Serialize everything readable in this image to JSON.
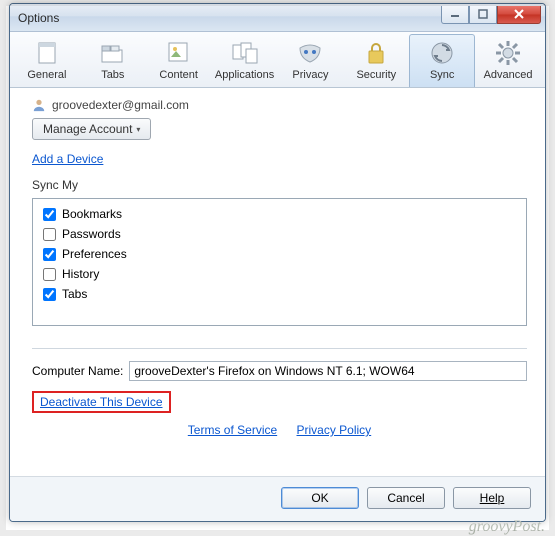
{
  "window": {
    "title": "Options"
  },
  "toolbar": {
    "items": [
      {
        "label": "General"
      },
      {
        "label": "Tabs"
      },
      {
        "label": "Content"
      },
      {
        "label": "Applications"
      },
      {
        "label": "Privacy"
      },
      {
        "label": "Security"
      },
      {
        "label": "Sync"
      },
      {
        "label": "Advanced"
      }
    ],
    "selected_index": 6
  },
  "account": {
    "email": "groovedexter@gmail.com",
    "manage_label": "Manage Account",
    "add_device_link": "Add a Device"
  },
  "sync": {
    "heading": "Sync My",
    "items": [
      {
        "label": "Bookmarks",
        "checked": true
      },
      {
        "label": "Passwords",
        "checked": false
      },
      {
        "label": "Preferences",
        "checked": true
      },
      {
        "label": "History",
        "checked": false
      },
      {
        "label": "Tabs",
        "checked": true
      }
    ]
  },
  "computer": {
    "label": "Computer Name:",
    "value": "grooveDexter's Firefox on Windows NT 6.1; WOW64"
  },
  "deactivate_link": "Deactivate This Device",
  "footer": {
    "tos": "Terms of Service",
    "privacy": "Privacy Policy"
  },
  "buttons": {
    "ok": "OK",
    "cancel": "Cancel",
    "help": "Help"
  },
  "watermark": "groovyPost."
}
